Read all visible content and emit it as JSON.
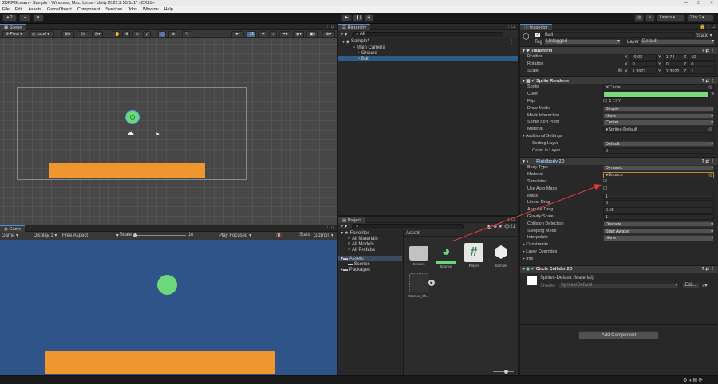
{
  "window": {
    "title": "2DRPGLearn - Sample - Windows, Mac, Linux - Unity 2022.3.55f1c1* <DX11>"
  },
  "menu": [
    "File",
    "Edit",
    "Assets",
    "GameObject",
    "Component",
    "Services",
    "Jobs",
    "Window",
    "Help"
  ],
  "toolbar": {
    "account": "2",
    "layers": "Layers",
    "layout": "2 by 3"
  },
  "scene": {
    "tab": "Scene",
    "pivot": "Pivot",
    "space": "Local",
    "gizmo_2d": "2D"
  },
  "game": {
    "tab": "Game",
    "mode": "Game",
    "display": "Display 1",
    "aspect": "Free Aspect",
    "scale_label": "Scale",
    "scale_value": "1x",
    "play_focused": "Play Focused",
    "stats": "Stats",
    "gizmos": "Gizmos"
  },
  "hierarchy": {
    "tab": "Hierarchy",
    "search": "All",
    "scene": "Sample*",
    "items": [
      "Main Camera",
      "Ground",
      "Ball"
    ]
  },
  "project": {
    "tab": "Project",
    "count": "21",
    "favorites": "Favorites",
    "fav_items": [
      "All Materials",
      "All Models",
      "All Prefabs"
    ],
    "assets_root": "Assets",
    "tree_items": [
      "Scenes"
    ],
    "packages": "Packages",
    "breadcrumb": "Assets",
    "assets": [
      {
        "name": "Scenes"
      },
      {
        "name": "Bounce"
      },
      {
        "name": "Player"
      },
      {
        "name": "Sample"
      },
      {
        "name": "Warrior_Sh..."
      }
    ]
  },
  "inspector": {
    "tab": "Inspector",
    "object_name": "Ball",
    "static": "Static",
    "tag_label": "Tag",
    "tag": "Untagged",
    "layer_label": "Layer",
    "layer": "Default",
    "transform": {
      "title": "Transform",
      "position_label": "Position",
      "position": [
        "-0.02",
        "1.74",
        "10"
      ],
      "rotation_label": "Rotation",
      "rotation": [
        "0",
        "0",
        "0"
      ],
      "scale_label": "Scale",
      "scale": [
        "1.3922",
        "1.3922",
        "1"
      ]
    },
    "sprite_renderer": {
      "title": "Sprite Renderer",
      "sprite_label": "Sprite",
      "sprite": "Circle",
      "color_label": "Color",
      "color": "#7ad97a",
      "flip_label": "Flip",
      "flip_x": "X",
      "flip_y": "Y",
      "draw_mode_label": "Draw Mode",
      "draw_mode": "Simple",
      "mask_label": "Mask Interaction",
      "mask": "None",
      "sort_point_label": "Sprite Sort Point",
      "sort_point": "Center",
      "material_label": "Material",
      "material": "Sprites-Default",
      "additional": "Additional Settings",
      "sorting_layer_label": "Sorting Layer",
      "sorting_layer": "Default",
      "order_label": "Order in Layer",
      "order": "0"
    },
    "rigidbody": {
      "title": "Rigidbody 2D",
      "body_type_label": "Body Type",
      "body_type": "Dynamic",
      "material_label": "Material",
      "material": "Bounce",
      "simulated_label": "Simulated",
      "auto_mass_label": "Use Auto Mass",
      "mass_label": "Mass",
      "mass": "1",
      "linear_drag_label": "Linear Drag",
      "linear_drag": "0",
      "angular_drag_label": "Angular Drag",
      "angular_drag": "0.05",
      "gravity_label": "Gravity Scale",
      "gravity": "1",
      "collision_label": "Collision Detection",
      "collision": "Discrete",
      "sleeping_label": "Sleeping Mode",
      "sleeping": "Start Awake",
      "interpolate_label": "Interpolate",
      "interpolate": "None",
      "constraints": "Constraints",
      "layer_overrides": "Layer Overrides",
      "info": "Info"
    },
    "circle_collider": {
      "title": "Circle Collider 2D"
    },
    "material_preview": {
      "name": "Sprites-Default (Material)",
      "shader_label": "Shader",
      "shader": "Sprites/Default",
      "edit": "Edit..."
    },
    "add_component": "Add Component"
  },
  "colors": {
    "ball": "#6bd97a",
    "ground": "#f0962e",
    "game_bg": "#2e5489",
    "annotation": "#e03a3a"
  }
}
